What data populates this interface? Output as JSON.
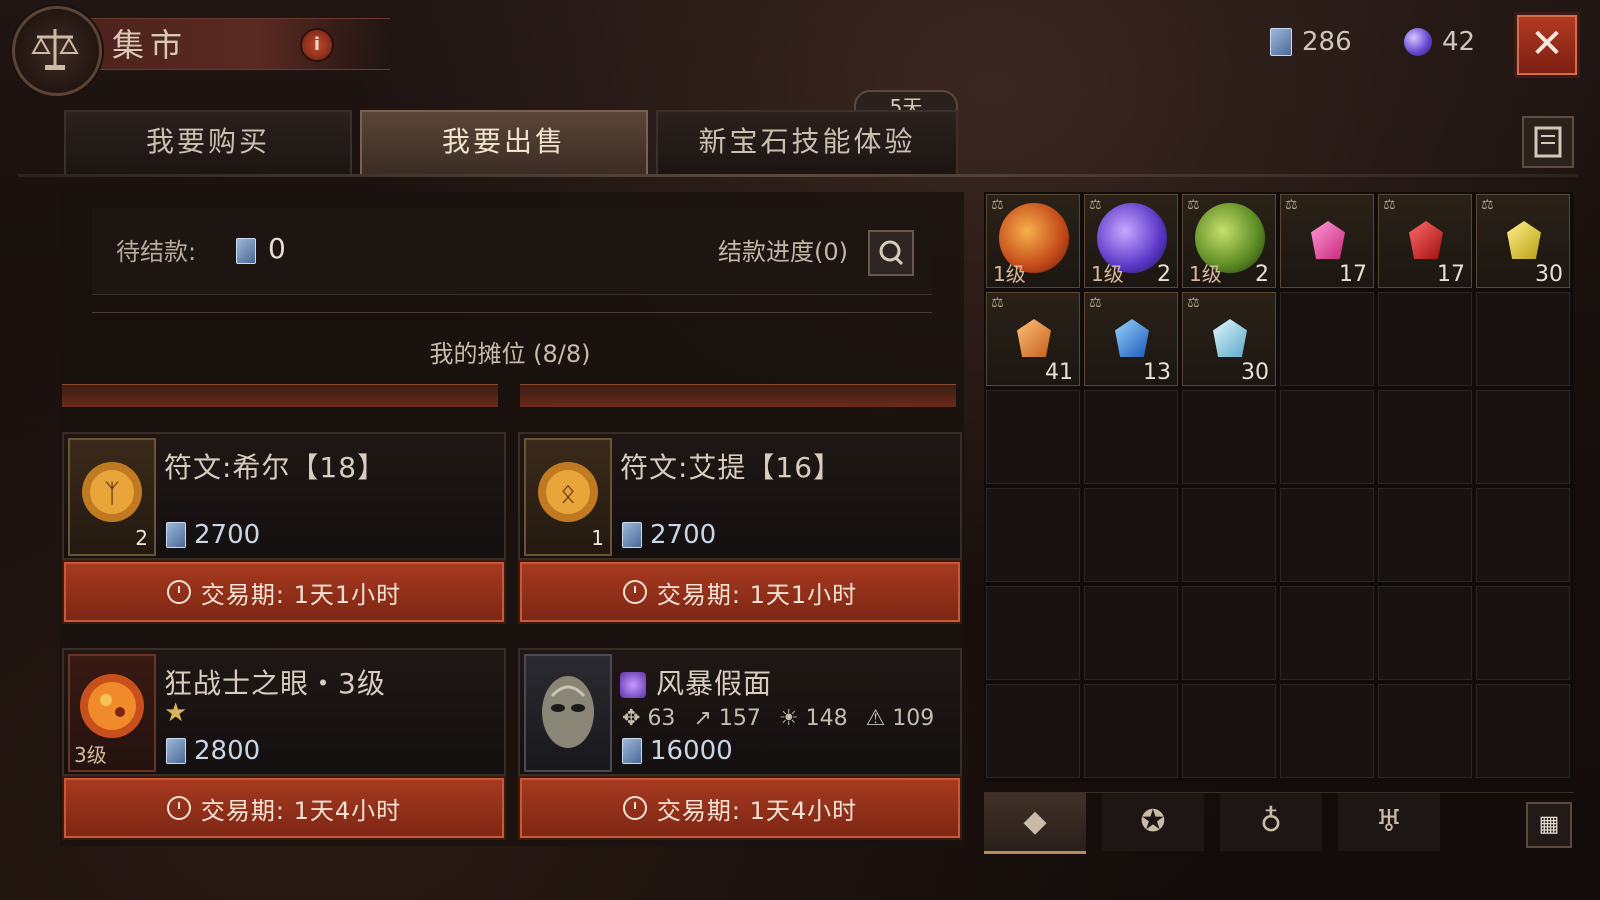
{
  "header": {
    "title": "集市",
    "info_icon": "info-icon",
    "gold_amount": "286",
    "orb_amount": "42",
    "close_icon": "close-icon"
  },
  "tabs": [
    {
      "label": "我要购买",
      "active": false
    },
    {
      "label": "我要出售",
      "active": true
    },
    {
      "label": "新宝石技能体验",
      "active": false
    }
  ],
  "event_badge": "5天",
  "pending": {
    "label": "待结款:",
    "value": "0",
    "progress_label": "结款进度(0)"
  },
  "stall_title": "我的摊位 (8/8)",
  "listings": [
    {
      "name": "符文:希尔【18】",
      "count": "2",
      "price": "2700",
      "period": "交易期: 1天1小时"
    },
    {
      "name": "符文:艾提【16】",
      "count": "1",
      "price": "2700",
      "period": "交易期: 1天1小时"
    },
    {
      "name": "狂战士之眼・3级",
      "level": "3级",
      "price": "2800",
      "period": "交易期: 1天4小时"
    },
    {
      "name": "风暴假面",
      "stats": [
        "63",
        "157",
        "148",
        "109"
      ],
      "price": "16000",
      "period": "交易期: 1天4小时"
    }
  ],
  "inventory": [
    {
      "level": "1级",
      "qty": ""
    },
    {
      "level": "1级",
      "qty": "2"
    },
    {
      "level": "1级",
      "qty": "2"
    },
    {
      "qty": "17"
    },
    {
      "qty": "17"
    },
    {
      "qty": "30"
    },
    {
      "qty": "41"
    },
    {
      "qty": "13"
    },
    {
      "qty": "30"
    }
  ],
  "colors": {
    "accent_red": "#a83a20",
    "gold_currency": "#9db7d8",
    "purple_orb": "#6a4cd6"
  }
}
